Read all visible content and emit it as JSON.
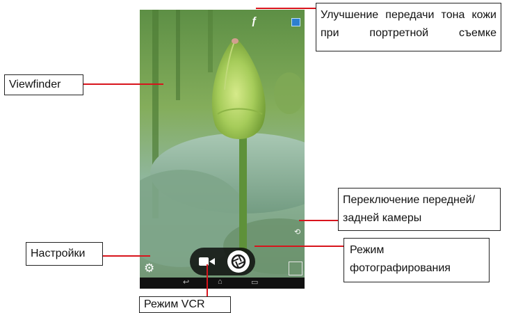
{
  "labels": {
    "skin_tone": "Улучшение передачи тона кожи при портретной съемке",
    "viewfinder": "Viewfinder",
    "settings": "Настройки",
    "switch_camera": "Переключение передней/задней камеры",
    "photo_mode": "Режим фотографирования",
    "vcr_mode": "Режим VCR"
  },
  "icons": {
    "skin_tone": "face-beauty-icon",
    "gallery": "gallery-thumbnail-icon",
    "switch_camera": "camera-switch-icon",
    "settings": "gear-icon",
    "video": "video-camera-icon",
    "shutter": "shutter-icon",
    "back": "back-icon",
    "home": "home-icon",
    "recents": "recents-icon"
  },
  "colors": {
    "leader_line": "#d8141c",
    "border": "#222222",
    "control_pill": "#141414"
  }
}
